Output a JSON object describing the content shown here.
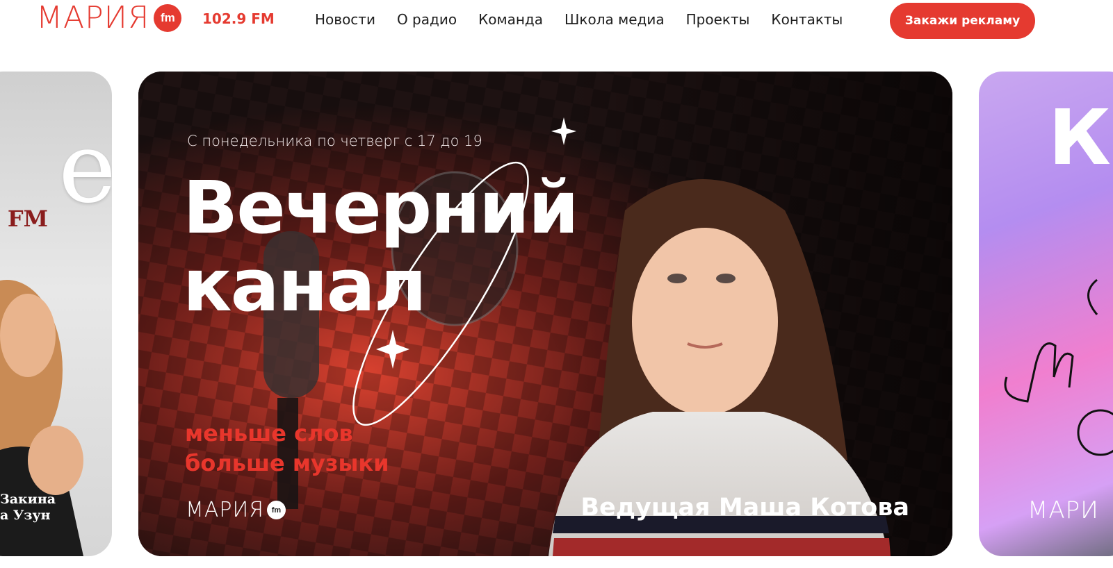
{
  "header": {
    "logo_word": "МАРИЯ",
    "logo_badge": "fm",
    "frequency": "102.9 FM",
    "nav": [
      {
        "label": "Новости"
      },
      {
        "label": "О радио"
      },
      {
        "label": "Команда"
      },
      {
        "label": "Школа медиа"
      },
      {
        "label": "Проекты"
      },
      {
        "label": "Контакты"
      }
    ],
    "cta_label": "Закажи рекламу"
  },
  "slides": {
    "left": {
      "big_letter": "e",
      "fm_text": "I FM",
      "caption_line1": "Закина",
      "caption_line2": "а Узун"
    },
    "main": {
      "tagline": "С понедельника по четверг с 17 до 19",
      "title_line1": "Вечерний",
      "title_line2": "канал",
      "subtitle_line1": "меньше слов",
      "subtitle_line2": "больше музыки",
      "logo_word": "МАРИЯ",
      "logo_badge": "fm",
      "host": "Ведущая Маша Котова"
    },
    "right": {
      "big_letter": "К",
      "logo_word": "МАРИ"
    }
  },
  "colors": {
    "brand_red": "#e53a30",
    "text_dark": "#1d1d1d",
    "subtitle_red": "#e8362c"
  }
}
